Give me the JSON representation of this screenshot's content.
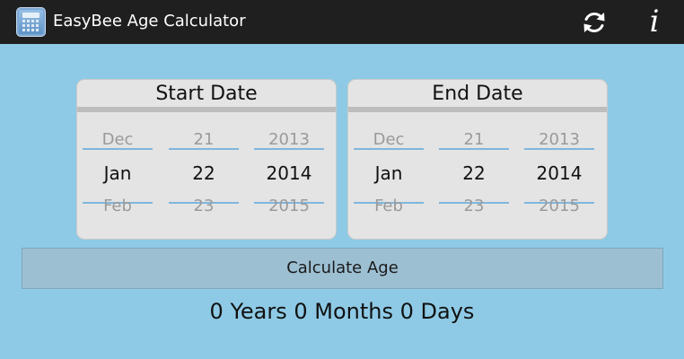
{
  "app": {
    "title": "EasyBee Age Calculator",
    "icons": {
      "app": "calculator-icon",
      "refresh": "refresh-icon",
      "info": "info-icon"
    },
    "info_glyph": "i"
  },
  "start_date": {
    "title": "Start Date",
    "month": {
      "prev": "Dec",
      "current": "Jan",
      "next": "Feb"
    },
    "day": {
      "prev": "21",
      "current": "22",
      "next": "23"
    },
    "year": {
      "prev": "2013",
      "current": "2014",
      "next": "2015"
    }
  },
  "end_date": {
    "title": "End Date",
    "month": {
      "prev": "Dec",
      "current": "Jan",
      "next": "Feb"
    },
    "day": {
      "prev": "21",
      "current": "22",
      "next": "23"
    },
    "year": {
      "prev": "2013",
      "current": "2014",
      "next": "2015"
    }
  },
  "calculate_button": {
    "label": "Calculate Age"
  },
  "result": {
    "text": "0 Years 0 Months 0 Days"
  },
  "colors": {
    "background": "#8ecae6",
    "action_bar": "#1f1f1f",
    "panel": "#e4e4e4",
    "picker_line": "#7fb6dd",
    "button": "#9dbfd2"
  }
}
